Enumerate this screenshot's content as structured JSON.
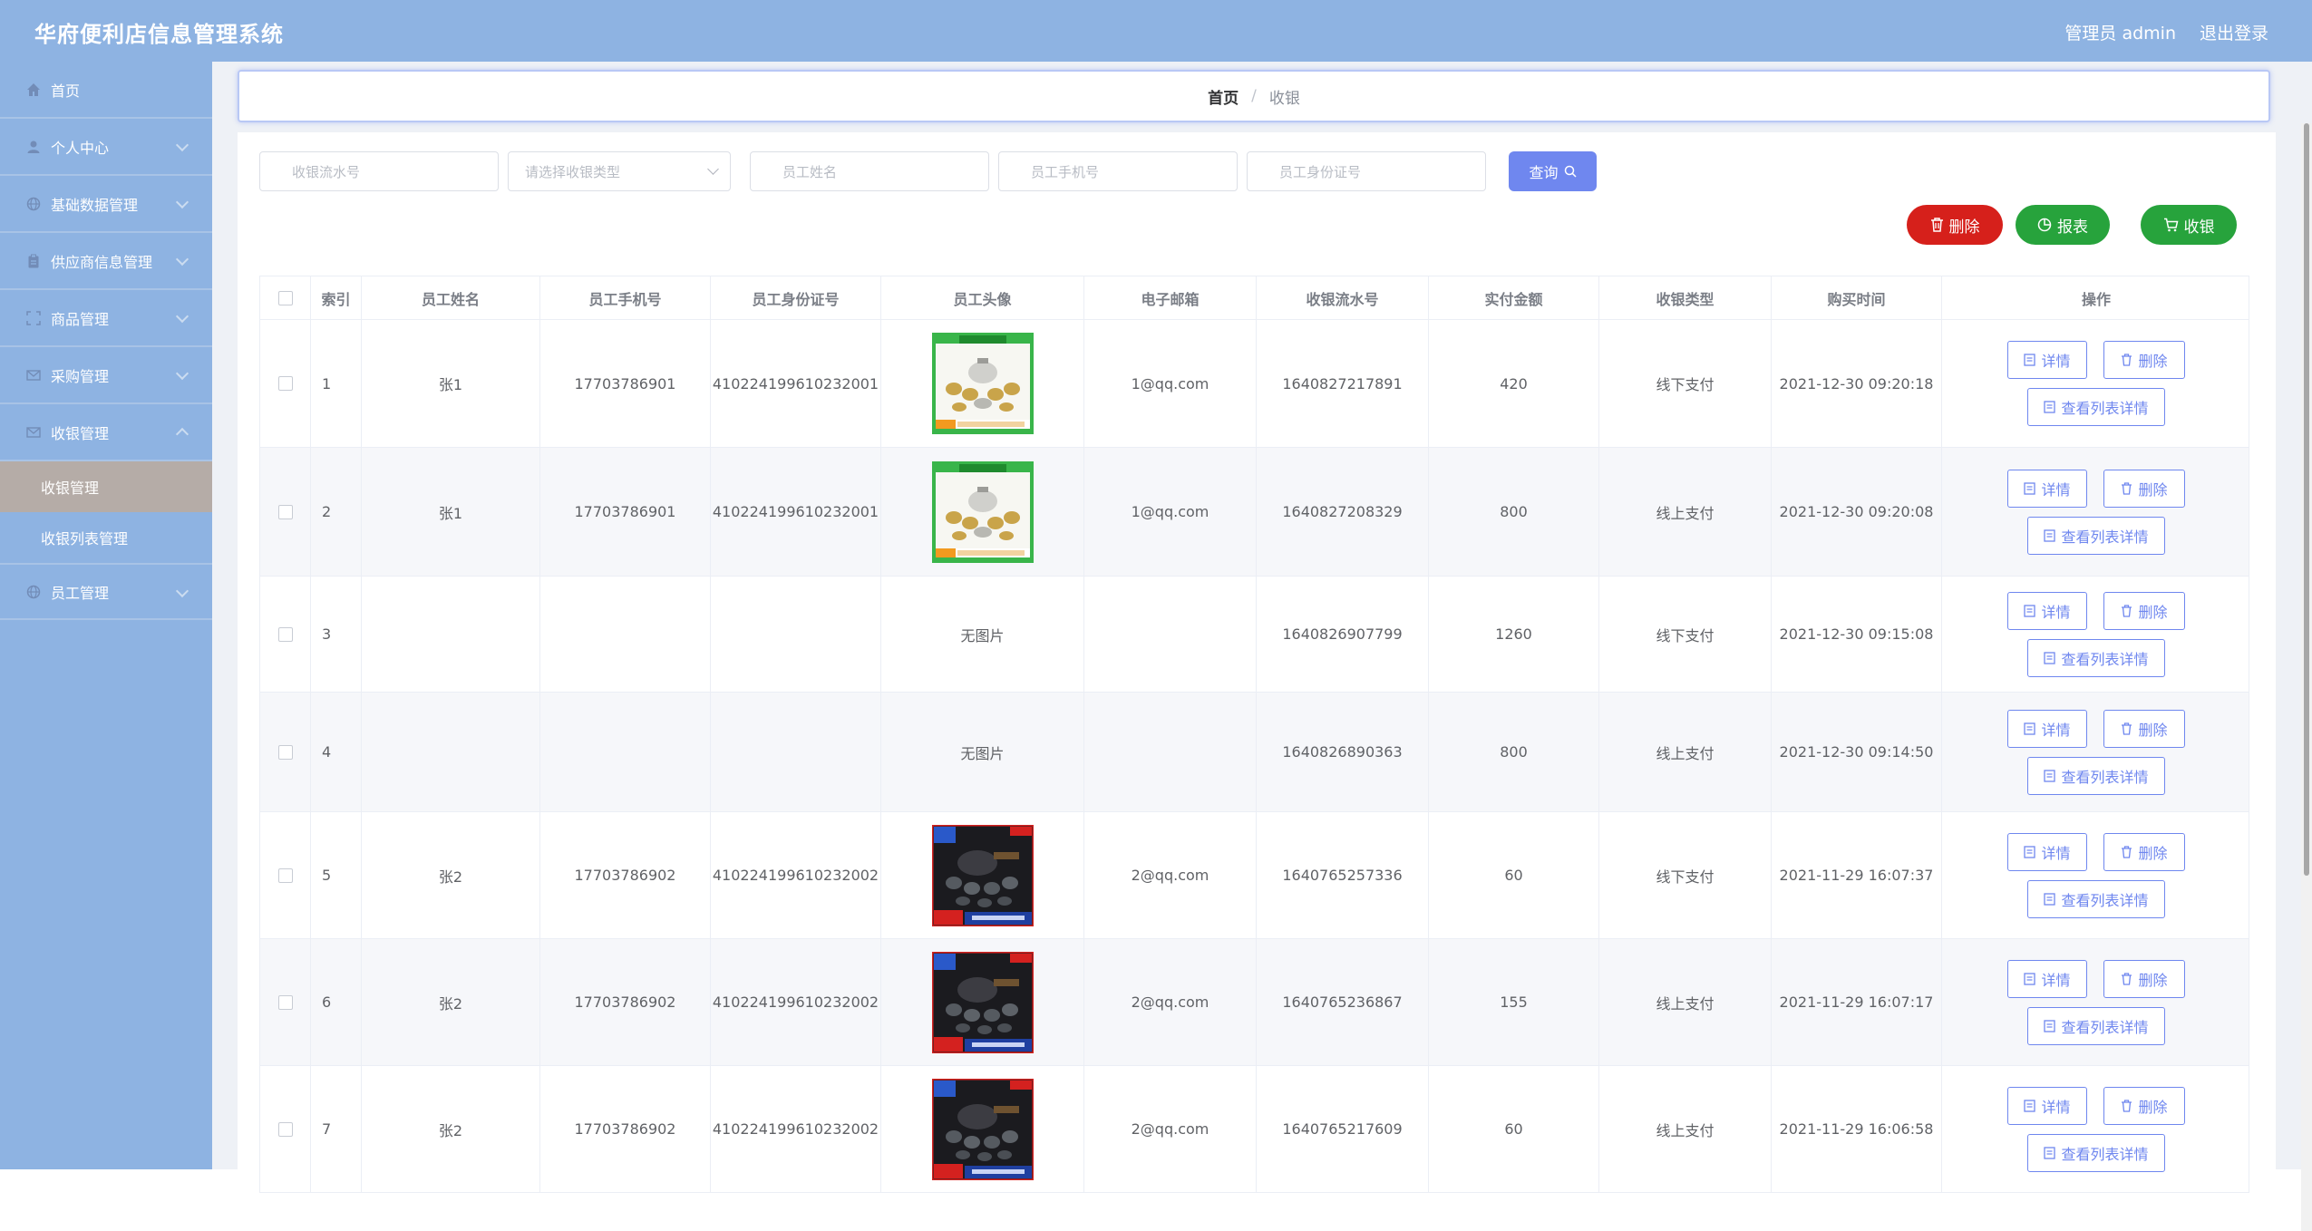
{
  "header": {
    "title": "华府便利店信息管理系统",
    "user": "管理员 admin",
    "logout": "退出登录"
  },
  "sidebar": {
    "items": [
      {
        "label": "首页",
        "icon": "home-icon"
      },
      {
        "label": "个人中心",
        "icon": "user-icon"
      },
      {
        "label": "基础数据管理",
        "icon": "globe-icon"
      },
      {
        "label": "供应商信息管理",
        "icon": "clipboard-icon"
      },
      {
        "label": "商品管理",
        "icon": "box-icon"
      },
      {
        "label": "采购管理",
        "icon": "mail-icon"
      },
      {
        "label": "收银管理",
        "icon": "mail-icon"
      }
    ],
    "sub": [
      "收银管理",
      "收银列表管理"
    ],
    "last": {
      "label": "员工管理",
      "icon": "globe-icon"
    }
  },
  "breadcrumb": {
    "home": "首页",
    "sep": "/",
    "current": "收银"
  },
  "search": {
    "flow_no": "收银流水号",
    "type_select": "请选择收银类型",
    "emp_name": "员工姓名",
    "emp_phone": "员工手机号",
    "emp_id": "员工身份证号",
    "query": "查询"
  },
  "actions": {
    "delete": "删除",
    "report": "报表",
    "cash": "收银"
  },
  "table": {
    "headers": [
      "索引",
      "员工姓名",
      "员工手机号",
      "员工身份证号",
      "员工头像",
      "电子邮箱",
      "收银流水号",
      "实付金额",
      "收银类型",
      "购买时间",
      "操作"
    ],
    "rows": [
      {
        "idx": "1",
        "name": "张1",
        "phone": "17703786901",
        "idcard": "410224199610232001",
        "avatar": "teaset-green",
        "email": "1@qq.com",
        "flow": "1640827217891",
        "amount": "420",
        "type": "线下支付",
        "time": "2021-12-30 09:20:18"
      },
      {
        "idx": "2",
        "name": "张1",
        "phone": "17703786901",
        "idcard": "410224199610232001",
        "avatar": "teaset-green",
        "email": "1@qq.com",
        "flow": "1640827208329",
        "amount": "800",
        "type": "线上支付",
        "time": "2021-12-30 09:20:08"
      },
      {
        "idx": "3",
        "name": "",
        "phone": "",
        "idcard": "",
        "avatar": "none",
        "noimg": "无图片",
        "email": "",
        "flow": "1640826907799",
        "amount": "1260",
        "type": "线下支付",
        "time": "2021-12-30 09:15:08"
      },
      {
        "idx": "4",
        "name": "",
        "phone": "",
        "idcard": "",
        "avatar": "none",
        "noimg": "无图片",
        "email": "",
        "flow": "1640826890363",
        "amount": "800",
        "type": "线上支付",
        "time": "2021-12-30 09:14:50"
      },
      {
        "idx": "5",
        "name": "张2",
        "phone": "17703786902",
        "idcard": "410224199610232002",
        "avatar": "teaset-dark",
        "email": "2@qq.com",
        "flow": "1640765257336",
        "amount": "60",
        "type": "线下支付",
        "time": "2021-11-29 16:07:37"
      },
      {
        "idx": "6",
        "name": "张2",
        "phone": "17703786902",
        "idcard": "410224199610232002",
        "avatar": "teaset-dark",
        "email": "2@qq.com",
        "flow": "1640765236867",
        "amount": "155",
        "type": "线上支付",
        "time": "2021-11-29 16:07:17"
      },
      {
        "idx": "7",
        "name": "张2",
        "phone": "17703786902",
        "idcard": "410224199610232002",
        "avatar": "teaset-dark",
        "email": "2@qq.com",
        "flow": "1640765217609",
        "amount": "60",
        "type": "线上支付",
        "time": "2021-11-29 16:06:58"
      }
    ],
    "op_detail": "详情",
    "op_delete": "删除",
    "op_list": "查看列表详情"
  },
  "colors": {
    "primary": "#6f87ef",
    "danger": "#d6201b",
    "success": "#27a33c",
    "sidebar": "#8eb3e2",
    "active_sub": "#b5aca7"
  }
}
